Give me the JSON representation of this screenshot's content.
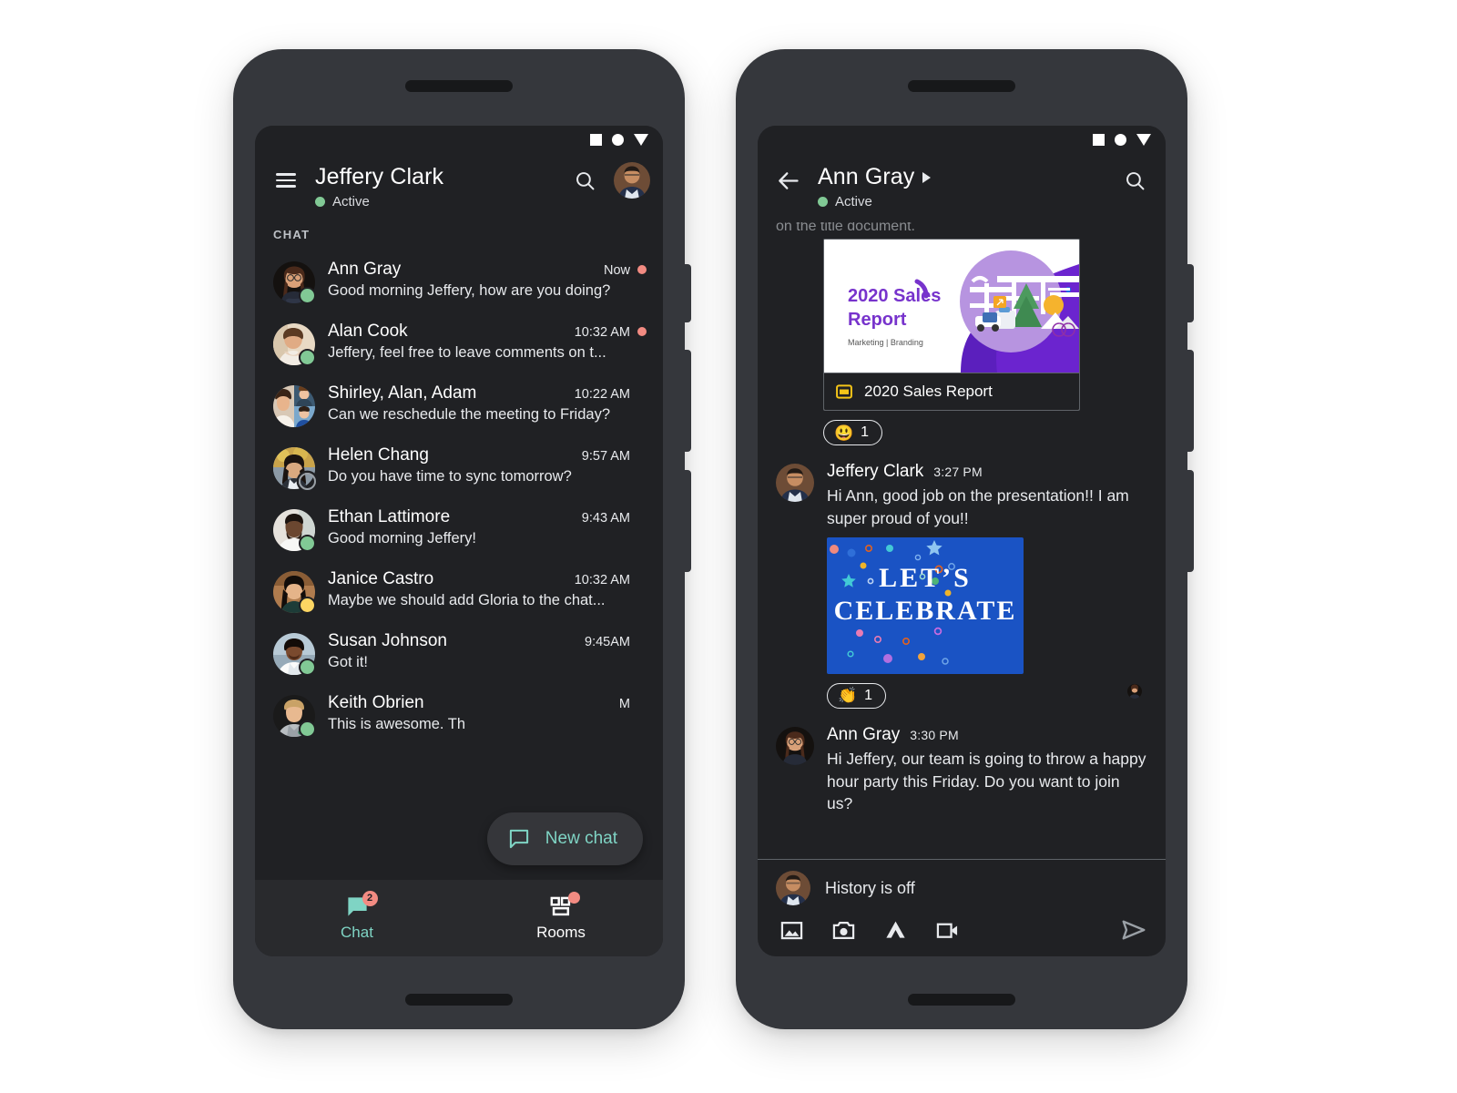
{
  "statusbar": {
    "icons": [
      "square-icon",
      "circle-icon",
      "triangle-down-icon"
    ]
  },
  "colors": {
    "accent_teal": "#7fd4c4",
    "unread_dot": "#f28b82",
    "online_green": "#81c995",
    "away_yellow": "#fdd663",
    "screen_bg": "#202124",
    "nav_bg": "#292a2d",
    "frame": "#35373c"
  },
  "left_phone": {
    "appbar": {
      "menu_icon": "hamburger-icon",
      "title": "Jeffery Clark",
      "presence": "Active",
      "search_icon": "search-icon",
      "avatar": "user-avatar"
    },
    "section_label": "CHAT",
    "chats": [
      {
        "name": "Ann Gray",
        "time": "Now",
        "message": "Good morning Jeffery, how are you doing?",
        "unread": true,
        "status": "online"
      },
      {
        "name": "Alan Cook",
        "time": "10:32 AM",
        "message": "Jeffery, feel free to leave comments on t...",
        "unread": true,
        "status": "online"
      },
      {
        "name": "Shirley, Alan, Adam",
        "time": "10:22 AM",
        "message": "Can we reschedule the meeting to Friday?",
        "unread": false,
        "status": "none"
      },
      {
        "name": "Helen Chang",
        "time": "9:57 AM",
        "message": "Do you have time to sync tomorrow?",
        "unread": false,
        "status": "offline"
      },
      {
        "name": "Ethan Lattimore",
        "time": "9:43 AM",
        "message": "Good morning Jeffery!",
        "unread": false,
        "status": "online"
      },
      {
        "name": "Janice Castro",
        "time": "10:32 AM",
        "message": "Maybe we should add Gloria to the chat...",
        "unread": false,
        "status": "away"
      },
      {
        "name": "Susan Johnson",
        "time": "9:45AM",
        "message": "Got it!",
        "unread": false,
        "status": "online"
      },
      {
        "name": "Keith Obrien",
        "time": "M",
        "message": "This is awesome. Th",
        "unread": false,
        "status": "online"
      }
    ],
    "fab": {
      "icon": "new-chat-icon",
      "label": "New chat"
    },
    "bottom_nav": [
      {
        "label": "Chat",
        "icon": "chat-bubble-icon",
        "badge": "2",
        "active": true
      },
      {
        "label": "Rooms",
        "icon": "rooms-icon",
        "badge": "",
        "active": false
      }
    ]
  },
  "right_phone": {
    "appbar": {
      "back_icon": "back-arrow-icon",
      "title": "Ann Gray",
      "title_caret": "caret-right-icon",
      "presence": "Active",
      "search_icon": "search-icon"
    },
    "clipped_top_text": "on the title document.",
    "attachment": {
      "slide_title_line1": "2020 Sales",
      "slide_title_line2": "Report",
      "slide_subtitle": "Marketing | Branding",
      "file_icon": "slides-icon",
      "file_name": "2020 Sales Report"
    },
    "attachment_reaction": {
      "emoji": "😃",
      "count": "1"
    },
    "messages": [
      {
        "author": "Jeffery Clark",
        "time": "3:27 PM",
        "text": "Hi Ann, good job on the presentation!! I am super proud of you!!",
        "image": "lets-celebrate-card",
        "image_line1": "LET’S",
        "image_line2": "CELEBRATE",
        "reaction": {
          "emoji": "👏",
          "count": "1"
        }
      },
      {
        "author": "Ann Gray",
        "time": "3:30 PM",
        "text": "Hi Jeffery, our team is going to throw a happy hour party this Friday. Do you want to join us?",
        "image": "",
        "reaction": null
      }
    ],
    "composer": {
      "avatar": "user-avatar",
      "placeholder": "History is off",
      "value": "",
      "tools": [
        "image-icon",
        "camera-icon",
        "drive-icon",
        "video-camera-icon"
      ],
      "send_icon": "send-icon"
    }
  }
}
